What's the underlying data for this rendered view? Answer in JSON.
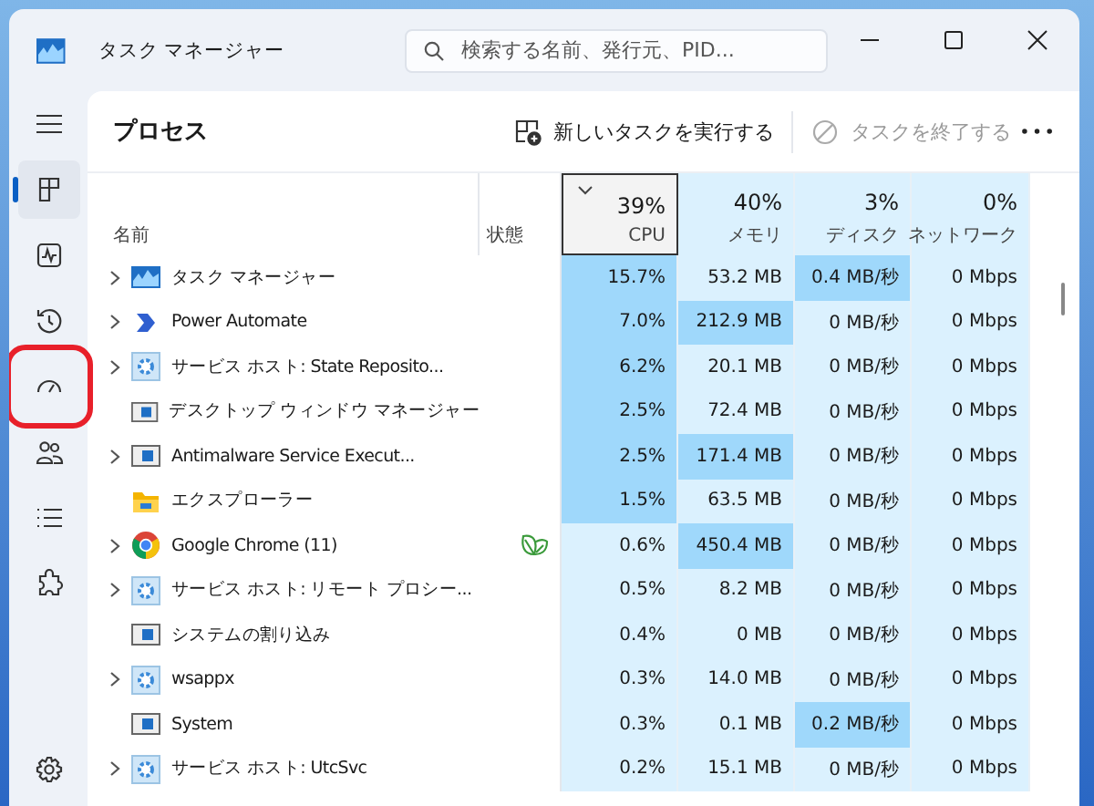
{
  "window": {
    "title": "タスク マネージャー"
  },
  "search": {
    "placeholder": "検索する名前、発行元、PID..."
  },
  "nav": [
    {
      "kind": "menu",
      "selected": false,
      "outlined": false
    },
    {
      "kind": "processes",
      "selected": true,
      "outlined": false
    },
    {
      "kind": "performance",
      "selected": false,
      "outlined": false
    },
    {
      "kind": "history",
      "selected": false,
      "outlined": false
    },
    {
      "kind": "startup",
      "selected": false,
      "outlined": true
    },
    {
      "kind": "users",
      "selected": false,
      "outlined": false
    },
    {
      "kind": "details",
      "selected": false,
      "outlined": false
    },
    {
      "kind": "services",
      "selected": false,
      "outlined": false
    }
  ],
  "settings": {
    "kind": "settings"
  },
  "toolbar": {
    "title": "プロセス",
    "actions": [
      {
        "label": "新しいタスクを実行する",
        "disabled": false
      },
      {
        "label": "タスクを終了する",
        "disabled": true
      }
    ]
  },
  "columns": [
    {
      "label": "名前"
    },
    {
      "label": "状態"
    },
    {
      "label": "CPU",
      "percent": "39%",
      "sorted": true
    },
    {
      "label": "メモリ",
      "percent": "40%",
      "sorted": false
    },
    {
      "label": "ディスク",
      "percent": "3%",
      "sorted": false
    },
    {
      "label": "ネットワーク",
      "percent": "0%",
      "sorted": false
    }
  ],
  "rows": [
    {
      "name": "タスク マネージャー",
      "kind": "taskmgr",
      "expandable": true,
      "efficiency": false,
      "cells": [
        {
          "text": "15.7%",
          "highlighted": true
        },
        {
          "text": "53.2 MB",
          "highlighted": false
        },
        {
          "text": "0.4 MB/秒",
          "highlighted": true
        },
        {
          "text": "0 Mbps",
          "highlighted": false
        }
      ]
    },
    {
      "name": "Power Automate",
      "kind": "automate",
      "expandable": true,
      "efficiency": false,
      "cells": [
        {
          "text": "7.0%",
          "highlighted": true
        },
        {
          "text": "212.9 MB",
          "highlighted": true
        },
        {
          "text": "0 MB/秒",
          "highlighted": false
        },
        {
          "text": "0 Mbps",
          "highlighted": false
        }
      ]
    },
    {
      "name": "サービス ホスト: State Reposito...",
      "kind": "gear",
      "expandable": true,
      "efficiency": false,
      "cells": [
        {
          "text": "6.2%",
          "highlighted": true
        },
        {
          "text": "20.1 MB",
          "highlighted": false
        },
        {
          "text": "0 MB/秒",
          "highlighted": false
        },
        {
          "text": "0 Mbps",
          "highlighted": false
        }
      ]
    },
    {
      "name": "デスクトップ ウィンドウ マネージャー",
      "kind": "window",
      "expandable": false,
      "efficiency": false,
      "cells": [
        {
          "text": "2.5%",
          "highlighted": true
        },
        {
          "text": "72.4 MB",
          "highlighted": false
        },
        {
          "text": "0 MB/秒",
          "highlighted": false
        },
        {
          "text": "0 Mbps",
          "highlighted": false
        }
      ]
    },
    {
      "name": "Antimalware Service Execut...",
      "kind": "window",
      "expandable": true,
      "efficiency": false,
      "cells": [
        {
          "text": "2.5%",
          "highlighted": true
        },
        {
          "text": "171.4 MB",
          "highlighted": true
        },
        {
          "text": "0 MB/秒",
          "highlighted": false
        },
        {
          "text": "0 Mbps",
          "highlighted": false
        }
      ]
    },
    {
      "name": "エクスプローラー",
      "kind": "folder",
      "expandable": false,
      "efficiency": false,
      "cells": [
        {
          "text": "1.5%",
          "highlighted": true
        },
        {
          "text": "63.5 MB",
          "highlighted": false
        },
        {
          "text": "0 MB/秒",
          "highlighted": false
        },
        {
          "text": "0 Mbps",
          "highlighted": false
        }
      ]
    },
    {
      "name": "Google Chrome (11)",
      "kind": "browser",
      "expandable": true,
      "efficiency": true,
      "cells": [
        {
          "text": "0.6%",
          "highlighted": false
        },
        {
          "text": "450.4 MB",
          "highlighted": true
        },
        {
          "text": "0 MB/秒",
          "highlighted": false
        },
        {
          "text": "0 Mbps",
          "highlighted": false
        }
      ]
    },
    {
      "name": "サービス ホスト: リモート プロシー...",
      "kind": "gear",
      "expandable": true,
      "efficiency": false,
      "cells": [
        {
          "text": "0.5%",
          "highlighted": false
        },
        {
          "text": "8.2 MB",
          "highlighted": false
        },
        {
          "text": "0 MB/秒",
          "highlighted": false
        },
        {
          "text": "0 Mbps",
          "highlighted": false
        }
      ]
    },
    {
      "name": "システムの割り込み",
      "kind": "window",
      "expandable": false,
      "efficiency": false,
      "cells": [
        {
          "text": "0.4%",
          "highlighted": false
        },
        {
          "text": "0 MB",
          "highlighted": false
        },
        {
          "text": "0 MB/秒",
          "highlighted": false
        },
        {
          "text": "0 Mbps",
          "highlighted": false
        }
      ]
    },
    {
      "name": "wsappx",
      "kind": "gear",
      "expandable": true,
      "efficiency": false,
      "cells": [
        {
          "text": "0.3%",
          "highlighted": false
        },
        {
          "text": "14.0 MB",
          "highlighted": false
        },
        {
          "text": "0 MB/秒",
          "highlighted": false
        },
        {
          "text": "0 Mbps",
          "highlighted": false
        }
      ]
    },
    {
      "name": "System",
      "kind": "window",
      "expandable": false,
      "efficiency": false,
      "cells": [
        {
          "text": "0.3%",
          "highlighted": false
        },
        {
          "text": "0.1 MB",
          "highlighted": false
        },
        {
          "text": "0.2 MB/秒",
          "highlighted": true
        },
        {
          "text": "0 Mbps",
          "highlighted": false
        }
      ]
    },
    {
      "name": "サービス ホスト: UtcSvc",
      "kind": "gear",
      "expandable": true,
      "efficiency": false,
      "cells": [
        {
          "text": "0.2%",
          "highlighted": false
        },
        {
          "text": "15.1 MB",
          "highlighted": false
        },
        {
          "text": "0 MB/秒",
          "highlighted": false
        },
        {
          "text": "0 Mbps",
          "highlighted": false
        }
      ]
    }
  ]
}
